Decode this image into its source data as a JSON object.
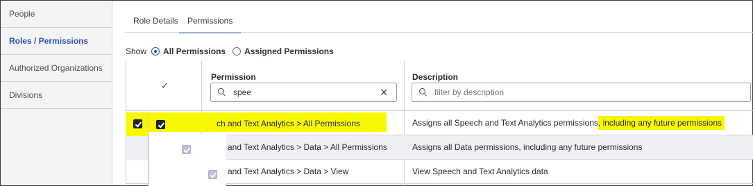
{
  "sidebar": {
    "items": [
      {
        "label": "People"
      },
      {
        "label": "Roles / Permissions",
        "active": true
      },
      {
        "label": "Authorized Organizations"
      },
      {
        "label": "Divisions"
      }
    ]
  },
  "tabs": [
    {
      "label": "Role Details"
    },
    {
      "label": "Permissions",
      "active": true
    }
  ],
  "show": {
    "label": "Show",
    "options": [
      {
        "label": "All Permissions",
        "selected": true
      },
      {
        "label": "Assigned Permissions",
        "selected": false
      }
    ]
  },
  "table": {
    "header_check": "✓",
    "permission_header": "Permission",
    "description_header": "Description",
    "permission_filter_value": "spee",
    "description_filter_placeholder": "filter by description",
    "rows": [
      {
        "permission": "ch and Text Analytics > All Permissions",
        "description": "Assigns all Speech and Text Analytics permissions",
        "description_highlight": ", including any future permissions",
        "checked": true
      },
      {
        "permission": "ch and Text Analytics > Data > All Permissions",
        "description": "Assigns all Data permissions, including any future permissions",
        "checked": true,
        "inherited": true
      },
      {
        "permission": "ch and Text Analytics > Data > View",
        "description": "View Speech and Text Analytics data",
        "checked": true,
        "inherited": true
      }
    ]
  },
  "colors": {
    "accent": "#2a56b8",
    "highlight": "#f8f800",
    "row_alt": "#eef0f4"
  }
}
